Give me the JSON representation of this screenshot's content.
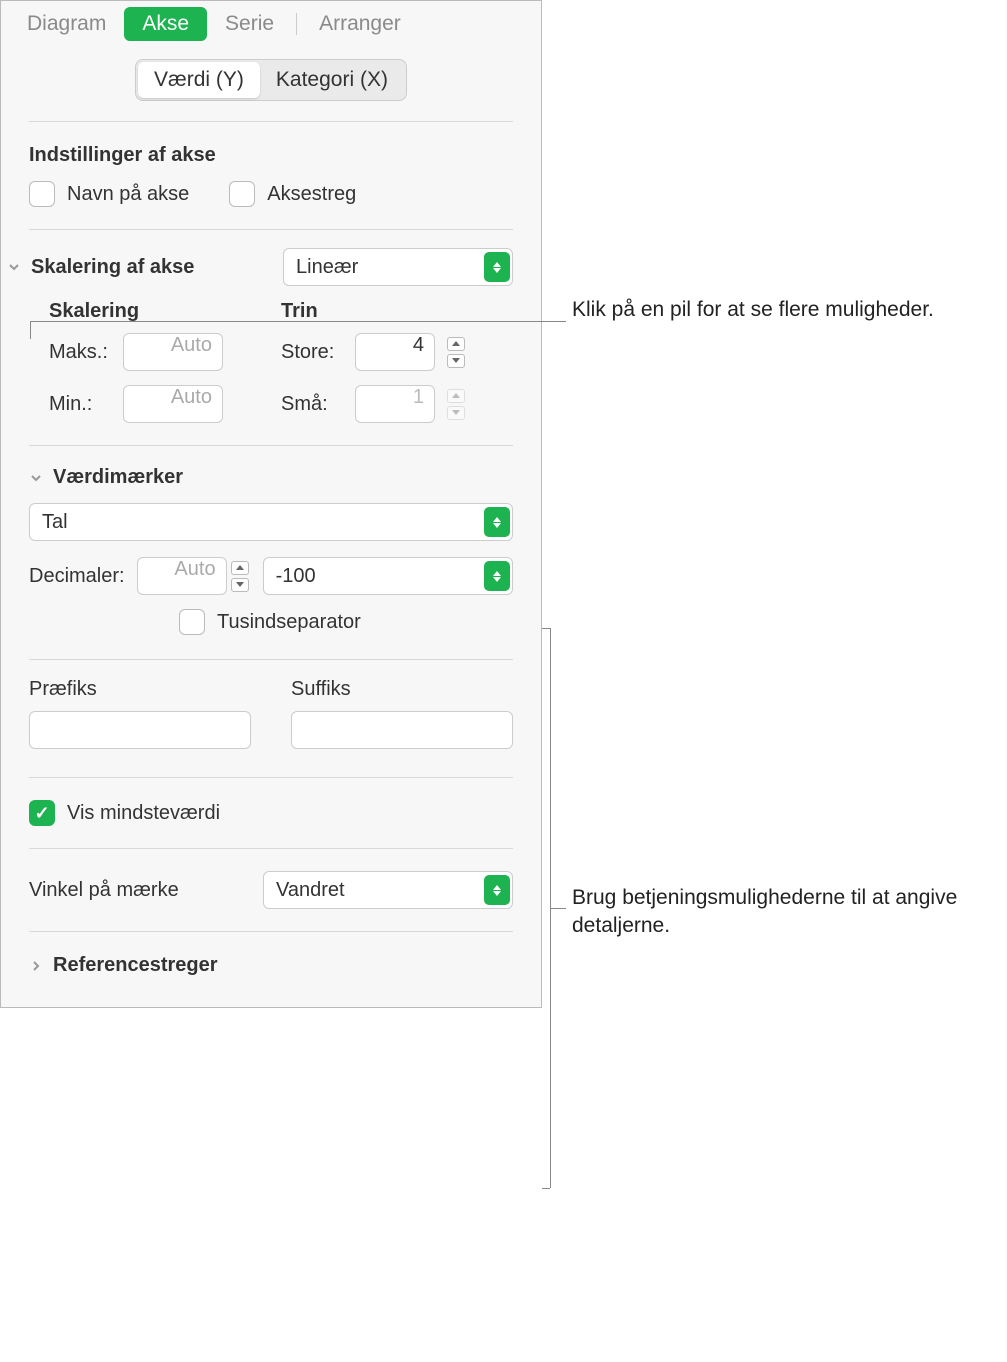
{
  "tabs": {
    "diagram": "Diagram",
    "akse": "Akse",
    "serie": "Serie",
    "arranger": "Arranger"
  },
  "subtabs": {
    "y": "Værdi (Y)",
    "x": "Kategori (X)"
  },
  "axisOptions": {
    "title": "Indstillinger af akse",
    "axisName": "Navn på akse",
    "axisLine": "Aksestreg"
  },
  "axisScale": {
    "title": "Skalering af akse",
    "select": "Lineær",
    "scaleTitle": "Skalering",
    "stepsTitle": "Trin",
    "maxLabel": "Maks.:",
    "minLabel": "Min.:",
    "autoPlaceholder": "Auto",
    "majorLabel": "Store:",
    "minorLabel": "Små:",
    "majorValue": "4",
    "minorValue": "1"
  },
  "valueLabels": {
    "title": "Værdimærker",
    "format": "Tal",
    "decimalsLabel": "Decimaler:",
    "decimalsPlaceholder": "Auto",
    "negFormat": "-100",
    "thousands": "Tusindseparator",
    "prefixLabel": "Præfiks",
    "suffixLabel": "Suffiks",
    "showMin": "Vis mindsteværdi",
    "angleLabel": "Vinkel på mærke",
    "angleValue": "Vandret"
  },
  "refLines": "Referencestreger",
  "callout1": "Klik på en pil for at se flere muligheder.",
  "callout2": "Brug betjeningsmulighederne til at angive detaljerne."
}
